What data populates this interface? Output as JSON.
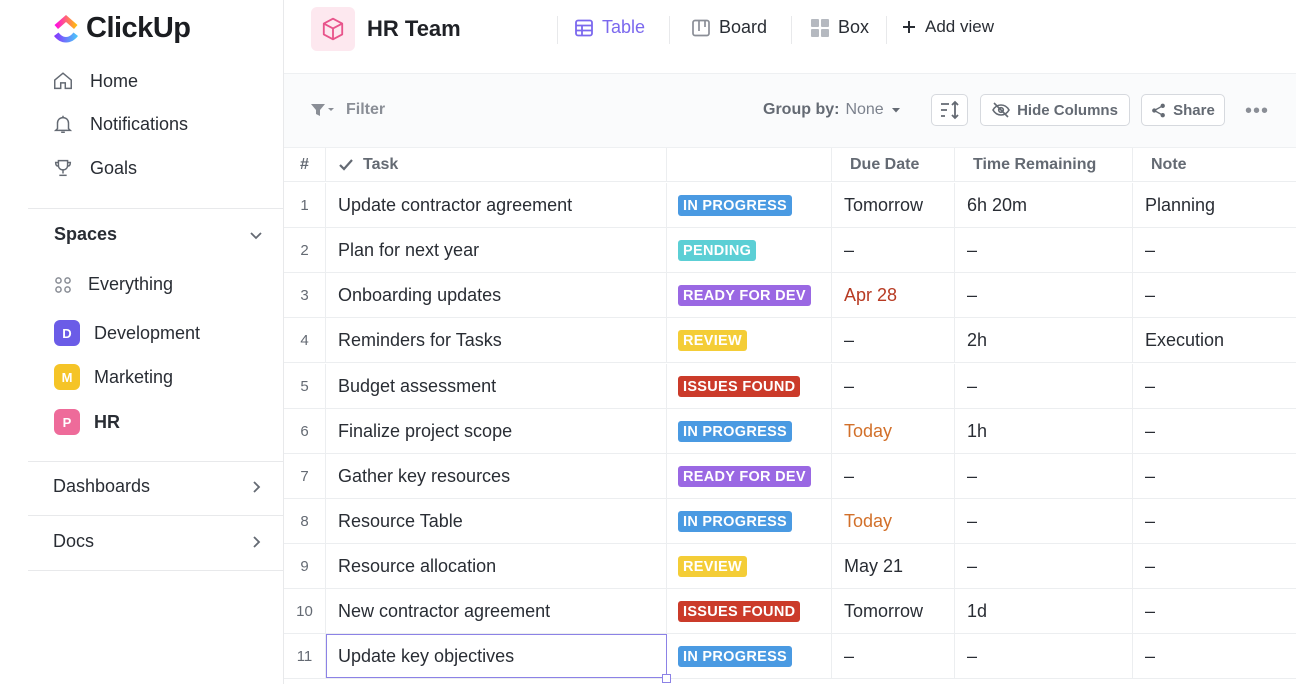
{
  "app": {
    "name": "ClickUp"
  },
  "sidebar": {
    "nav": [
      {
        "label": "Home",
        "icon": "home-icon"
      },
      {
        "label": "Notifications",
        "icon": "bell-icon"
      },
      {
        "label": "Goals",
        "icon": "trophy-icon"
      }
    ],
    "spaces_label": "Spaces",
    "everything_label": "Everything",
    "spaces": [
      {
        "initial": "D",
        "label": "Development",
        "color": "#6b5ce7"
      },
      {
        "initial": "M",
        "label": "Marketing",
        "color": "#f5c427"
      },
      {
        "initial": "P",
        "label": "HR",
        "color": "#ee6b9a"
      }
    ],
    "dashboards_label": "Dashboards",
    "docs_label": "Docs"
  },
  "header": {
    "title": "HR Team",
    "views": [
      {
        "label": "Table",
        "icon": "table-icon",
        "active": true
      },
      {
        "label": "Board",
        "icon": "board-icon",
        "active": false
      },
      {
        "label": "Box",
        "icon": "box-icon",
        "active": false
      }
    ],
    "add_view_label": "Add view"
  },
  "toolbar": {
    "filter_label": "Filter",
    "group_by_label": "Group by:",
    "group_by_value": "None",
    "hide_columns_label": "Hide Columns",
    "share_label": "Share"
  },
  "table": {
    "columns": {
      "num": "#",
      "task": "Task",
      "status": "",
      "due": "Due Date",
      "remaining": "Time Remaining",
      "note": "Note"
    },
    "status_colors": {
      "IN PROGRESS": "#4a9ae2",
      "PENDING": "#5ccfd5",
      "READY FOR DEV": "#9a68e3",
      "REVIEW": "#f4cd37",
      "ISSUES FOUND": "#cb3b2a"
    },
    "rows": [
      {
        "num": "1",
        "task": "Update contractor agreement",
        "status": "IN PROGRESS",
        "due": "Tomorrow",
        "due_style": "",
        "remaining": "6h 20m",
        "note": "Planning"
      },
      {
        "num": "2",
        "task": "Plan for next year",
        "status": "PENDING",
        "due": "–",
        "due_style": "",
        "remaining": "–",
        "note": "–"
      },
      {
        "num": "3",
        "task": "Onboarding updates",
        "status": "READY FOR DEV",
        "due": "Apr 28",
        "due_style": "red",
        "remaining": "–",
        "note": "–"
      },
      {
        "num": "4",
        "task": "Reminders for Tasks",
        "status": "REVIEW",
        "due": "–",
        "due_style": "",
        "remaining": "2h",
        "note": "Execution"
      },
      {
        "num": "5",
        "task": "Budget assessment",
        "status": "ISSUES FOUND",
        "due": "–",
        "due_style": "",
        "remaining": "–",
        "note": "–"
      },
      {
        "num": "6",
        "task": "Finalize project scope",
        "status": "IN PROGRESS",
        "due": "Today",
        "due_style": "orange",
        "remaining": "1h",
        "note": "–"
      },
      {
        "num": "7",
        "task": "Gather key resources",
        "status": "READY FOR DEV",
        "due": "–",
        "due_style": "",
        "remaining": "–",
        "note": "–"
      },
      {
        "num": "8",
        "task": "Resource Table",
        "status": "IN PROGRESS",
        "due": "Today",
        "due_style": "orange",
        "remaining": "–",
        "note": "–"
      },
      {
        "num": "9",
        "task": "Resource allocation",
        "status": "REVIEW",
        "due": "May 21",
        "due_style": "",
        "remaining": "–",
        "note": "–"
      },
      {
        "num": "10",
        "task": "New contractor agreement",
        "status": "ISSUES FOUND",
        "due": "Tomorrow",
        "due_style": "",
        "remaining": "1d",
        "note": "–"
      },
      {
        "num": "11",
        "task": "Update key objectives",
        "status": "IN PROGRESS",
        "due": "–",
        "due_style": "",
        "remaining": "–",
        "note": "–"
      }
    ]
  }
}
